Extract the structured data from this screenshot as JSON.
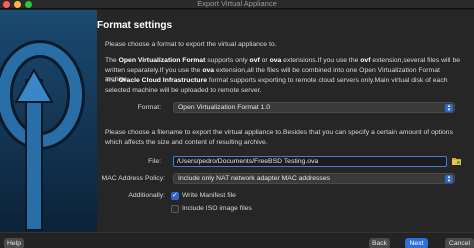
{
  "window": {
    "title": "Export Virtual Appliance"
  },
  "heading": "Format settings",
  "intro": "Please choose a format to export the virtual appliance to.",
  "ovf_para": {
    "pre": "The ",
    "bold1": "Open Virtualization Format",
    "mid1": " supports only ",
    "bold2": "ovf",
    "mid2": " or ",
    "bold3": "ova",
    "mid3": " extensions.If you use the ",
    "bold4": "ovf",
    "mid4": " extension,several files will be written separately.If you use the ",
    "bold5": "ova",
    "post": " extension,all the files will be combined into one Open Virtualization Format archive."
  },
  "oci_para": {
    "pre": "The ",
    "bold1": "Oracle Cloud Infrastructure",
    "post": " format supports exporting to remote cloud servers only.Main virtual disk of each selected machine will be uploaded to remote server."
  },
  "format": {
    "label": "Format:",
    "value": "Open Virtualization Format 1.0"
  },
  "file_para": "Please choose a filename to export the virtual appliance to.Besides that you can specify a certain amount of options which affects the size and content of resulting archive.",
  "file": {
    "label": "File:",
    "value": "/Users/pedro/Documents/FreeBSD Testing.ova"
  },
  "mac": {
    "label": "MAC Address Policy:",
    "value": "Include only NAT network adapter MAC addresses"
  },
  "additionally": {
    "label": "Additionally:",
    "options": [
      {
        "label": "Write Manifest file",
        "checked": true
      },
      {
        "label": "Include ISO image files",
        "checked": false
      }
    ]
  },
  "buttons": {
    "help": "Help",
    "back": "Back",
    "next": "Next",
    "cancel": "Cancel"
  },
  "colors": {
    "accent": "#2f6fd8",
    "background": "#262626",
    "input_border": "#3f7be0"
  },
  "icons": [
    "close-light-icon",
    "minimize-light-icon",
    "zoom-light-icon",
    "folder-icon",
    "check-icon",
    "up-down-arrow-icon",
    "virtualbox-export-art"
  ]
}
